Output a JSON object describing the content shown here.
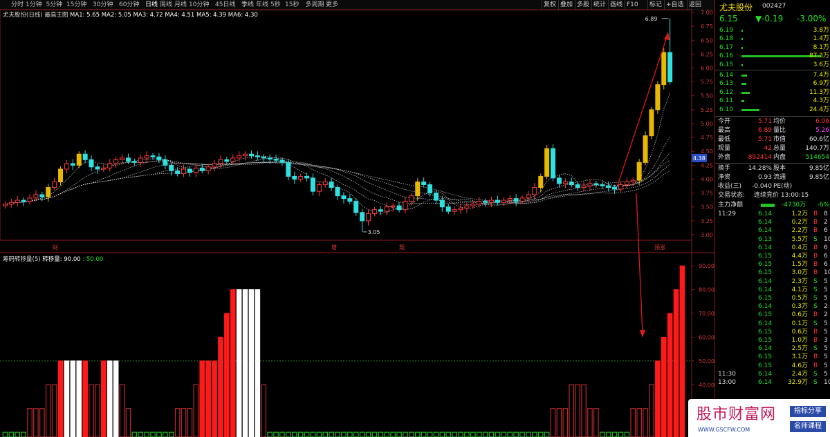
{
  "toolbar": {
    "tabs": [
      "分时",
      "1分钟",
      "5分钟",
      "15分钟",
      "30分钟",
      "60分钟",
      "日线",
      "周线",
      "月线",
      "10分钟",
      "45日线",
      "季线",
      "年线",
      "5秒",
      "15秒",
      "多周期",
      "更多"
    ],
    "right": [
      "复权",
      "叠加",
      "多股",
      "统计",
      "画线",
      "F10",
      "标记",
      "+自选",
      "返回"
    ]
  },
  "upper": {
    "title": "尤夫股份(日线)",
    "indicator": "最高主图",
    "ma": [
      {
        "label": "MA1: 5.65",
        "color": "#ffffff"
      },
      {
        "label": "MA2: 5.05",
        "color": "#ffffff"
      },
      {
        "label": "MA3: 4.72",
        "color": "#ffffff"
      },
      {
        "label": "MA4: 4.51",
        "color": "#ffffff"
      },
      {
        "label": "MA5: 4.39",
        "color": "#ffffff"
      },
      {
        "label": "MA6: 4.30",
        "color": "#ffffff"
      }
    ],
    "max_label": "6.89",
    "min_label": "3.05",
    "cur_label": "4.38",
    "event_labels": [
      "财",
      "增",
      "题",
      "预涨"
    ]
  },
  "lower": {
    "title": "筹码转移量(5)",
    "legend1": "转移量: 90.00",
    "legend2": ": 50.00"
  },
  "chart_data": [
    {
      "type": "candlestick",
      "title": "尤夫股份(日线)",
      "ylim": [
        2.9,
        7.05
      ],
      "yticks": [
        3.0,
        3.25,
        3.5,
        3.75,
        4.0,
        4.25,
        4.5,
        4.75,
        5.0,
        5.25,
        5.5,
        5.75,
        6.0,
        6.25,
        6.5,
        6.75,
        7.0
      ],
      "close": [
        3.55,
        3.58,
        3.62,
        3.6,
        3.66,
        3.72,
        3.68,
        3.85,
        3.95,
        4.18,
        4.28,
        4.25,
        4.45,
        4.35,
        4.22,
        4.18,
        4.2,
        4.28,
        4.35,
        4.38,
        4.32,
        4.3,
        4.38,
        4.42,
        4.4,
        4.35,
        4.25,
        4.15,
        4.1,
        4.18,
        4.12,
        4.2,
        4.15,
        4.22,
        4.28,
        4.35,
        4.32,
        4.38,
        4.42,
        4.45,
        4.42,
        4.4,
        4.38,
        4.36,
        4.34,
        4.3,
        4.05,
        4.0,
        4.05,
        4.02,
        3.78,
        3.9,
        3.95,
        3.85,
        3.7,
        3.65,
        3.6,
        3.4,
        3.25,
        3.38,
        3.45,
        3.42,
        3.5,
        3.52,
        3.45,
        3.6,
        3.7,
        3.95,
        3.9,
        3.75,
        3.62,
        3.5,
        3.42,
        3.45,
        3.48,
        3.52,
        3.55,
        3.6,
        3.58,
        3.62,
        3.58,
        3.62,
        3.65,
        3.6,
        3.66,
        3.72,
        3.85,
        4.05,
        4.55,
        4.02,
        3.92,
        3.95,
        3.9,
        3.85,
        3.88,
        3.92,
        3.9,
        3.88,
        3.85,
        3.82,
        3.9,
        3.95,
        3.98,
        4.3,
        4.78,
        5.25,
        5.7,
        6.28,
        5.75
      ]
    },
    {
      "type": "bar",
      "title": "筹码转移量(5)",
      "ylim": [
        18,
        95
      ],
      "yticks": [
        20,
        30,
        40,
        50,
        60,
        70,
        80,
        90
      ],
      "reference_line": 50,
      "values": [
        20,
        20,
        20,
        20,
        30,
        30,
        30,
        40,
        40,
        50,
        50,
        50,
        50,
        50,
        40,
        40,
        50,
        50,
        50,
        40,
        30,
        20,
        20,
        20,
        20,
        20,
        20,
        20,
        30,
        30,
        30,
        40,
        50,
        50,
        50,
        60,
        70,
        80,
        80,
        80,
        80,
        80,
        40,
        20,
        20,
        20,
        20,
        20,
        20,
        20,
        20,
        20,
        20,
        20,
        20,
        20,
        20,
        20,
        20,
        20,
        20,
        20,
        20,
        20,
        20,
        20,
        20,
        20,
        20,
        20,
        20,
        20,
        20,
        20,
        20,
        20,
        20,
        20,
        20,
        20,
        20,
        20,
        20,
        20,
        20,
        20,
        20,
        20,
        20,
        30,
        30,
        30,
        40,
        40,
        40,
        30,
        30,
        20,
        20,
        20,
        20,
        20,
        30,
        30,
        30,
        40,
        50,
        60,
        70,
        80,
        90
      ],
      "colors": [
        "g",
        "g",
        "g",
        "g",
        "R",
        "R",
        "R",
        "R",
        "R",
        "F",
        "F",
        "F",
        "F",
        "F",
        "R",
        "R",
        "F",
        "F",
        "F",
        "R",
        "R",
        "g",
        "g",
        "g",
        "g",
        "g",
        "g",
        "g",
        "R",
        "R",
        "R",
        "R",
        "F",
        "F",
        "F",
        "F",
        "F",
        "F",
        "W",
        "W",
        "W",
        "W",
        "R",
        "g",
        "g",
        "g",
        "g",
        "g",
        "g",
        "g",
        "g",
        "g",
        "g",
        "g",
        "g",
        "g",
        "g",
        "g",
        "g",
        "g",
        "g",
        "g",
        "g",
        "g",
        "g",
        "g",
        "g",
        "g",
        "g",
        "g",
        "g",
        "g",
        "g",
        "g",
        "g",
        "g",
        "g",
        "g",
        "g",
        "g",
        "g",
        "g",
        "g",
        "g",
        "g",
        "g",
        "g",
        "g",
        "g",
        "R",
        "R",
        "R",
        "R",
        "R",
        "R",
        "R",
        "R",
        "g",
        "g",
        "g",
        "g",
        "g",
        "R",
        "R",
        "R",
        "R",
        "F",
        "F",
        "F",
        "F",
        "F"
      ]
    }
  ],
  "quote": {
    "name": "尤夫股份",
    "code": "002427",
    "price": "6.15",
    "change": "▼-0.19",
    "pct": "-3.00%",
    "sells": [
      {
        "p": "6.19",
        "v": "3.8万",
        "bar": 2
      },
      {
        "p": "6.18",
        "v": "1.4万",
        "bar": 2
      },
      {
        "p": "6.17",
        "v": "8.1万",
        "bar": 2
      },
      {
        "p": "6.16",
        "v": "87.3万",
        "bar": 115
      },
      {
        "p": "6.15",
        "v": "3.6万",
        "bar": 2
      }
    ],
    "buys": [
      {
        "p": "6.14",
        "v": "7.4万",
        "bar": 8
      },
      {
        "p": "6.13",
        "v": "6.9万",
        "bar": 7
      },
      {
        "p": "6.12",
        "v": "11.3万",
        "bar": 12
      },
      {
        "p": "6.11",
        "v": "4.3万",
        "bar": 4
      },
      {
        "p": "6.10",
        "v": "24.4万",
        "bar": 26
      }
    ],
    "stats": [
      {
        "k1": "今开",
        "v1": "5.71",
        "c1": "r",
        "k2": "均价",
        "v2": "6.06",
        "c2": "r"
      },
      {
        "k1": "最高",
        "v1": "6.89",
        "c1": "r",
        "k2": "量比",
        "v2": "5.26",
        "c2": "m"
      },
      {
        "k1": "最低",
        "v1": "5.71",
        "c1": "r",
        "k2": "市值",
        "v2": "60.6亿",
        "c2": "w"
      },
      {
        "k1": "现量",
        "v1": "42",
        "c1": "r",
        "k2": "总量",
        "v2": "140.7万",
        "c2": "w"
      },
      {
        "k1": "外盘",
        "v1": "892414",
        "c1": "r",
        "k2": "内盘",
        "v2": "514654",
        "c2": "g"
      }
    ],
    "stats2": [
      {
        "k1": "换手",
        "v1": "14.28%",
        "c1": "w",
        "k2": "股本",
        "v2": "9.85亿",
        "c2": "w"
      },
      {
        "k1": "净资",
        "v1": "0.93",
        "c1": "w",
        "k2": "流通",
        "v2": "9.85亿",
        "c2": "w"
      },
      {
        "k1": "收益(三)",
        "v1": "-0.040",
        "c1": "w",
        "k2": "PE(动)",
        "v2": "",
        "c2": "w"
      }
    ],
    "status_label": "交易状态:",
    "status": "连续竞价 13:00:15",
    "main_label": "主力净额",
    "main_value": "-4730万",
    "main_pct": "-6%",
    "ticks": [
      {
        "t": "11:29",
        "p": "6.14",
        "v": "1.2万",
        "s": "B",
        "n": "8"
      },
      {
        "t": "",
        "p": "6.14",
        "v": "0.2万",
        "s": "B",
        "n": "2"
      },
      {
        "t": "",
        "p": "6.14",
        "v": "2.2万",
        "s": "B",
        "n": "6"
      },
      {
        "t": "",
        "p": "6.13",
        "v": "5.5万",
        "s": "S",
        "n": "10"
      },
      {
        "t": "",
        "p": "6.14",
        "v": "0.4万",
        "s": "B",
        "n": "6"
      },
      {
        "t": "",
        "p": "6.15",
        "v": "4.4万",
        "s": "B",
        "n": "6"
      },
      {
        "t": "",
        "p": "6.15",
        "v": "1.5万",
        "s": "B",
        "n": "6"
      },
      {
        "t": "",
        "p": "6.15",
        "v": "3.0万",
        "s": "B",
        "n": "10"
      },
      {
        "t": "",
        "p": "6.14",
        "v": "2.3万",
        "s": "S",
        "n": "5"
      },
      {
        "t": "",
        "p": "6.14",
        "v": "4.1万",
        "s": "S",
        "n": "5"
      },
      {
        "t": "",
        "p": "6.15",
        "v": "0.5万",
        "s": "S",
        "n": "5"
      },
      {
        "t": "",
        "p": "6.14",
        "v": "0.3万",
        "s": "S",
        "n": "2"
      },
      {
        "t": "",
        "p": "6.15",
        "v": "0.6万",
        "s": "B",
        "n": "2"
      },
      {
        "t": "",
        "p": "6.14",
        "v": "0.1万",
        "s": "S",
        "n": "5"
      },
      {
        "t": "",
        "p": "6.15",
        "v": "0.6万",
        "s": "B",
        "n": "5"
      },
      {
        "t": "",
        "p": "6.15",
        "v": "1.0万",
        "s": "B",
        "n": "3"
      },
      {
        "t": "",
        "p": "6.14",
        "v": "2.5万",
        "s": "S",
        "n": "5"
      },
      {
        "t": "",
        "p": "6.15",
        "v": "3.1万",
        "s": "B",
        "n": "5"
      },
      {
        "t": "",
        "p": "6.15",
        "v": "4.6万",
        "s": "B",
        "n": "5"
      },
      {
        "t": "11:30",
        "p": "6.14",
        "v": "2.4万",
        "s": "S",
        "n": "5"
      },
      {
        "t": "13:00",
        "p": "6.14",
        "v": "32.9万",
        "s": "S",
        "n": "10"
      }
    ]
  },
  "watermark": {
    "title": "股市财富网",
    "url": "WWW.GSCFW.COM",
    "badge1": "指标分享",
    "badge2": "名师课程"
  }
}
